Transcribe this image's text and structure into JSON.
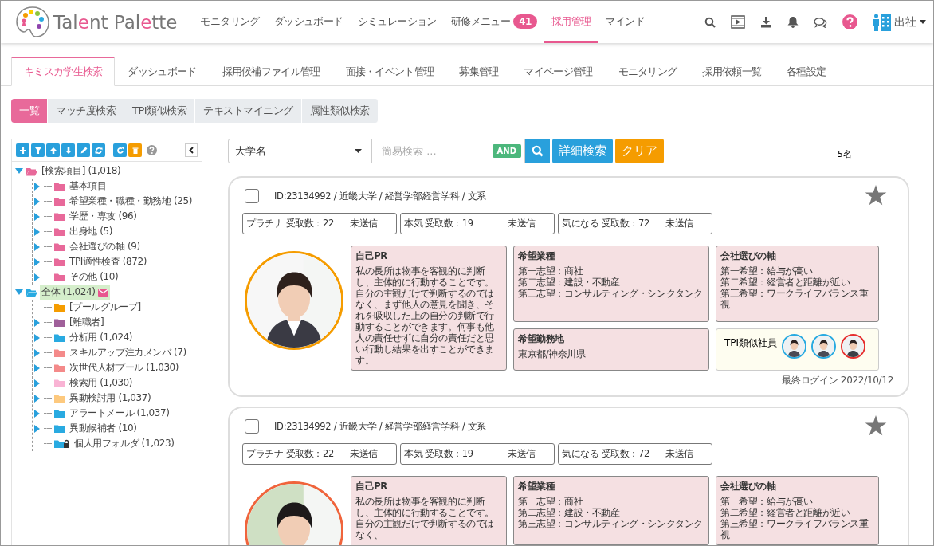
{
  "header": {
    "logo": "Tal**e**nt Pal**e**tte",
    "nav": [
      {
        "label": "モニタリング",
        "selected": false
      },
      {
        "label": "ダッシュボード",
        "selected": false
      },
      {
        "label": "シミュレーション",
        "selected": false
      },
      {
        "label": "研修メニュー",
        "selected": false,
        "badge": "41"
      },
      {
        "label": "採用管理",
        "selected": true
      },
      {
        "label": "マインド",
        "selected": false
      }
    ],
    "status": "出社"
  },
  "subtabs": [
    {
      "label": "キミスカ学生検索",
      "selected": true
    },
    {
      "label": "ダッシュボード",
      "selected": false
    },
    {
      "label": "採用候補ファイル管理",
      "selected": false
    },
    {
      "label": "面接・イベント管理",
      "selected": false
    },
    {
      "label": "募集管理",
      "selected": false
    },
    {
      "label": "マイページ管理",
      "selected": false
    },
    {
      "label": "モニタリング",
      "selected": false
    },
    {
      "label": "採用依頼一覧",
      "selected": false
    },
    {
      "label": "各種設定",
      "selected": false
    }
  ],
  "view_tabs": [
    {
      "label": "一覧",
      "selected": true
    },
    {
      "label": "マッチ度検索",
      "selected": false
    },
    {
      "label": "TPI類似検索",
      "selected": false
    },
    {
      "label": "テキストマイニング",
      "selected": false
    },
    {
      "label": "属性類似検索",
      "selected": false
    }
  ],
  "sidebar": {
    "tree": [
      {
        "label": "[検索項目] (1,018)",
        "color": "#e8699a",
        "kind": "branch",
        "expanded": true,
        "selected": false,
        "mail": false,
        "children": [
          {
            "label": "基本項目",
            "color": "#e8699a",
            "kind": "branch",
            "expanded": false,
            "selected": false
          },
          {
            "label": "希望業種・職種・勤務地 (25)",
            "color": "#e8699a",
            "kind": "branch",
            "expanded": false,
            "selected": false
          },
          {
            "label": "学歴・専攻 (96)",
            "color": "#e8699a",
            "kind": "branch",
            "expanded": false,
            "selected": false
          },
          {
            "label": "出身地 (5)",
            "color": "#e8699a",
            "kind": "branch",
            "expanded": false,
            "selected": false
          },
          {
            "label": "会社選びの軸 (9)",
            "color": "#e8699a",
            "kind": "branch",
            "expanded": false,
            "selected": false
          },
          {
            "label": "TPI適性検査 (872)",
            "color": "#e8699a",
            "kind": "branch",
            "expanded": false,
            "selected": false
          },
          {
            "label": "その他 (10)",
            "color": "#e8699a",
            "kind": "branch",
            "expanded": false,
            "selected": false
          }
        ]
      },
      {
        "label": "全体 (1,024)",
        "color": "#29aae1",
        "kind": "branch",
        "expanded": true,
        "selected": true,
        "mail": true,
        "children": [
          {
            "label": "[プールグループ]",
            "color": "#f59c00",
            "kind": "leaf",
            "selected": false,
            "locked": false
          },
          {
            "label": "[離職者]",
            "color": "#a0609a",
            "kind": "branch",
            "expanded": false,
            "selected": false,
            "locked": false
          },
          {
            "label": "分析用 (1,024)",
            "color": "#29aae1",
            "kind": "branch",
            "expanded": false,
            "selected": false,
            "locked": false
          },
          {
            "label": "スキルアップ注力メンバ (7)",
            "color": "#f48a8a",
            "kind": "branch",
            "expanded": false,
            "selected": false,
            "locked": false
          },
          {
            "label": "次世代人材プール (1,030)",
            "color": "#f48a8a",
            "kind": "branch",
            "expanded": false,
            "selected": false,
            "locked": false
          },
          {
            "label": "検索用 (1,030)",
            "color": "#f9b3d4",
            "kind": "branch",
            "expanded": false,
            "selected": false,
            "locked": false
          },
          {
            "label": "異動検討用 (1,037)",
            "color": "#fdc97e",
            "kind": "branch",
            "expanded": false,
            "selected": false,
            "locked": false
          },
          {
            "label": "アラートメール (1,037)",
            "color": "#29aae1",
            "kind": "branch",
            "expanded": false,
            "selected": false,
            "locked": false
          },
          {
            "label": "異動候補者 (10)",
            "color": "#29aae1",
            "kind": "branch",
            "expanded": false,
            "selected": false,
            "locked": false
          },
          {
            "label": "個人用フォルダ (1,023)",
            "color": "#29aae1",
            "kind": "leaf",
            "selected": false,
            "locked": true
          }
        ]
      }
    ]
  },
  "search": {
    "field": "大学名",
    "placeholder": "簡易検索 ...",
    "operator": "AND",
    "buttons": [
      {
        "label": "詳細検索",
        "kind": "primary"
      },
      {
        "label": "クリア",
        "kind": "warning"
      }
    ]
  },
  "result_count": "5名",
  "candidates": [
    {
      "checked": false,
      "favorite": false,
      "id_line": "ID:23134992 / 近畿大学 / 経営学部経営学科 / 文系",
      "counts": [
        {
          "label": "プラチナ 受取数：22",
          "status": "未送信"
        },
        {
          "label": "本気 受取数：19",
          "status": "未送信"
        },
        {
          "label": "気になる 受取数：72",
          "status": "未送信"
        }
      ],
      "photo": {
        "kind": "picture",
        "color": "#f59c00"
      },
      "panels": [
        {
          "kind": "pr",
          "title": "自己PR",
          "text": "私の長所は物事を客観的に判断し、主体的に行動することです。自分の主観だけで判断するのではなく、まず他人の意見を聞き、それを吸収した上の自分の判断で行動することができます。何事も他人の責任せずに自分の責任だと思い行動し結果を出すことができます。"
        },
        {
          "kind": "list",
          "title": "希望業種",
          "lines": [
            "第一志望：商社",
            "第二志望：建設・不動産",
            "第三志望：コンサルティング・シンクタンク"
          ]
        },
        {
          "kind": "list",
          "title": "会社選びの軸",
          "lines": [
            "第一希望：給与が高い",
            "第二希望：経営者と距離が近い",
            "第三希望：ワークライフバランス重視"
          ]
        },
        {
          "kind": "list",
          "title": "希望勤務地",
          "lines": [
            "東京都/神奈川県"
          ]
        },
        {
          "kind": "similar",
          "title": "TPI類似社員",
          "avatars": [
            {
              "color": "#29aae1"
            },
            {
              "color": "#29aae1"
            },
            {
              "color": "#e62e2e"
            }
          ]
        }
      ],
      "last_login": "最終ログイン 2022/10/12"
    },
    {
      "checked": false,
      "favorite": false,
      "id_line": "ID:23134992 / 近畿大学 / 経営学部経営学科 / 文系",
      "counts": [
        {
          "label": "プラチナ 受取数：22",
          "status": "未送信"
        },
        {
          "label": "本気 受取数：19",
          "status": "未送信"
        },
        {
          "label": "気になる 受取数：72",
          "status": "未送信"
        }
      ],
      "photo": {
        "kind": "picture",
        "color": "#f0643c"
      },
      "panels": [
        {
          "kind": "pr",
          "title": "自己PR",
          "text": "私の長所は物事を客観的に判断し、主体的に行動することです。自分の主観だけで判断するのではなく、"
        },
        {
          "kind": "list",
          "title": "希望業種",
          "lines": [
            "第一志望：商社",
            "第二志望：建設・不動産",
            "第三志望：コンサルティング・シンクタンク"
          ]
        },
        {
          "kind": "list",
          "title": "会社選びの軸",
          "lines": [
            "第一希望：給与が高い",
            "第二希望：経営者と距離が近い",
            "第三希望：ワークライフバランス重視"
          ]
        }
      ]
    }
  ]
}
